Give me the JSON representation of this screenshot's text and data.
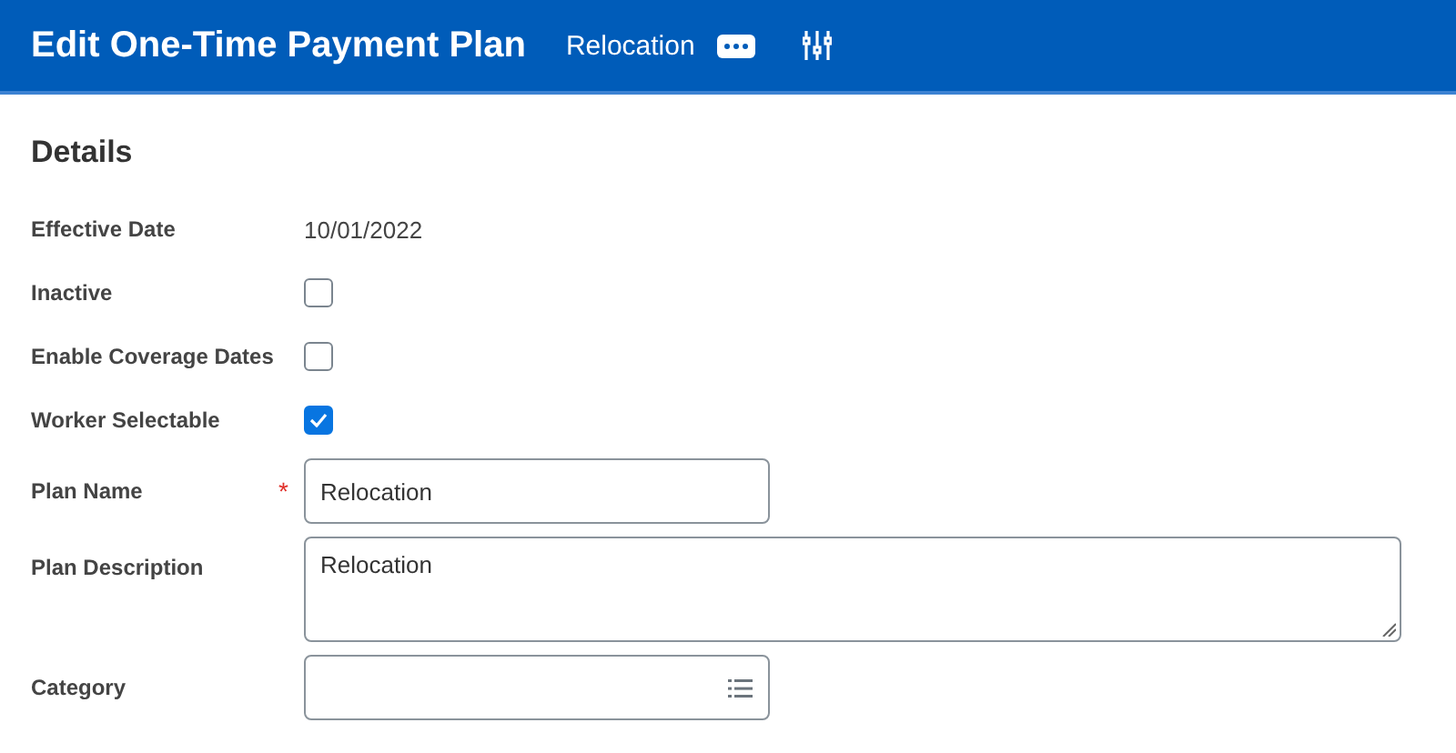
{
  "header": {
    "title": "Edit One-Time Payment Plan",
    "subtitle": "Relocation"
  },
  "section": {
    "title": "Details"
  },
  "fields": [
    {
      "kind": "text",
      "label": "Effective Date",
      "value": "10/01/2022"
    },
    {
      "kind": "checkbox",
      "label": "Inactive",
      "checked": false
    },
    {
      "kind": "checkbox",
      "label": "Enable Coverage Dates",
      "checked": false
    },
    {
      "kind": "checkbox",
      "label": "Worker Selectable",
      "checked": true
    },
    {
      "kind": "input",
      "label": "Plan Name",
      "value": "Relocation",
      "required_mark": "*"
    },
    {
      "kind": "textarea",
      "label": "Plan Description",
      "value": "Relocation"
    },
    {
      "kind": "select",
      "label": "Category"
    }
  ]
}
